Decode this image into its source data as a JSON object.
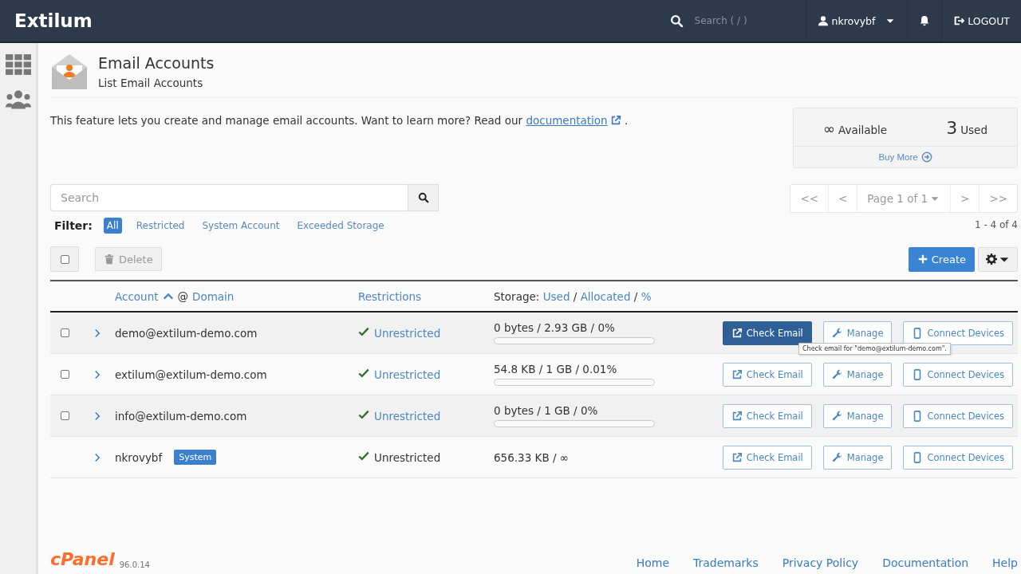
{
  "header": {
    "brand": "Extilum",
    "search": {
      "placeholder": "Search ( / )"
    },
    "user": "nkrovybf",
    "logout": "LOGOUT"
  },
  "sidebar": {
    "items": [
      {
        "kind": "grid"
      },
      {
        "kind": "users"
      }
    ]
  },
  "page": {
    "title": "Email Accounts",
    "subtitle": "List Email Accounts"
  },
  "intro": {
    "text": "This feature lets you create and manage email accounts. Want to learn more? Read our",
    "link": "documentation",
    "end": "."
  },
  "stats": {
    "available_value": "∞",
    "available_label": "Available",
    "used_value": "3",
    "used_label": "Used",
    "buy_more": "Buy More"
  },
  "search": {
    "placeholder": "Search"
  },
  "pagination": {
    "first": "<<",
    "prev": "<",
    "page": "Page 1 of 1",
    "next": ">",
    "last": ">>",
    "range": "1 - 4 of 4"
  },
  "filter": {
    "label": "Filter:",
    "options": [
      {
        "label": "All",
        "selected": true
      },
      {
        "label": "Restricted",
        "selected": false
      },
      {
        "label": "System Account",
        "selected": false
      },
      {
        "label": "Exceeded Storage",
        "selected": false
      }
    ]
  },
  "toolbar": {
    "select_all_checked": false,
    "delete": "Delete",
    "create": "Create"
  },
  "table": {
    "columns": {
      "account": "Account",
      "at": "@",
      "domain": "Domain",
      "restrictions": "Restrictions",
      "storage": "Storage:",
      "used": "Used",
      "allocated": "Allocated",
      "percent": "%",
      "sep": "/"
    },
    "rows": [
      {
        "kind": "email",
        "checked": false,
        "account": "demo@extilum-demo.com",
        "restriction": "Unrestricted",
        "storage": "0 bytes / 2.93 GB / 0%",
        "level": 0,
        "check_email": "Check Email",
        "check_email_hover": true,
        "tooltip": "Check email for \"demo@extilum-demo.com\".",
        "manage": "Manage",
        "connect": "Connect Devices"
      },
      {
        "kind": "email",
        "checked": false,
        "account": "extilum@extilum-demo.com",
        "restriction": "Unrestricted",
        "storage": "54.8 KB / 1 GB / 0.01%",
        "level": 0.0001,
        "check_email": "Check Email",
        "check_email_hover": false,
        "manage": "Manage",
        "connect": "Connect Devices"
      },
      {
        "kind": "email",
        "checked": false,
        "account": "info@extilum-demo.com",
        "restriction": "Unrestricted",
        "storage": "0 bytes / 1 GB / 0%",
        "level": 0,
        "check_email": "Check Email",
        "check_email_hover": false,
        "manage": "Manage",
        "connect": "Connect Devices"
      },
      {
        "kind": "system",
        "account": "nkrovybf",
        "badge": "System",
        "restriction": "Unrestricted",
        "storage": "656.33 KB / ∞",
        "check_email": "Check Email",
        "check_email_hover": false,
        "manage": "Manage",
        "connect": "Connect Devices"
      }
    ]
  },
  "footer": {
    "logo": "cPanel",
    "version": "96.0.14",
    "links": [
      "Home",
      "Trademarks",
      "Privacy Policy",
      "Documentation",
      "Help"
    ]
  }
}
